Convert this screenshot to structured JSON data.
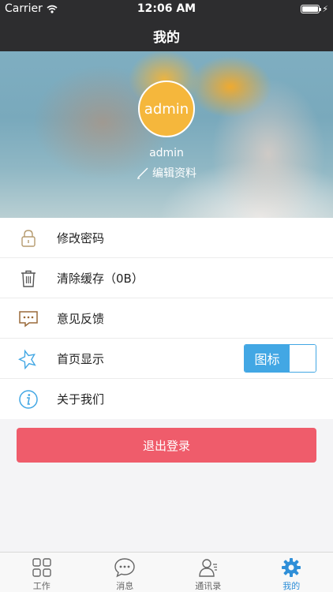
{
  "status": {
    "carrier": "Carrier",
    "time": "12:06 AM"
  },
  "nav": {
    "title": "我的"
  },
  "profile": {
    "avatar_text": "admin",
    "username": "admin",
    "edit_label": "编辑资料"
  },
  "menu": [
    {
      "label": "修改密码",
      "icon": "lock-icon"
    },
    {
      "label": "清除缓存（0B）",
      "icon": "trash-icon"
    },
    {
      "label": "意见反馈",
      "icon": "feedback-icon"
    },
    {
      "label": "首页显示",
      "icon": "star-icon",
      "toggle_label": "图标"
    },
    {
      "label": "关于我们",
      "icon": "info-icon"
    }
  ],
  "logout_label": "退出登录",
  "tabs": [
    {
      "label": "工作",
      "icon": "grid-icon"
    },
    {
      "label": "消息",
      "icon": "chat-icon"
    },
    {
      "label": "通讯录",
      "icon": "contacts-icon"
    },
    {
      "label": "我的",
      "icon": "gear-icon",
      "active": true
    }
  ],
  "colors": {
    "accent": "#42a7e4",
    "logout": "#ef5c6b",
    "avatar": "#f5b73c",
    "tab_active": "#2f8fd8"
  }
}
